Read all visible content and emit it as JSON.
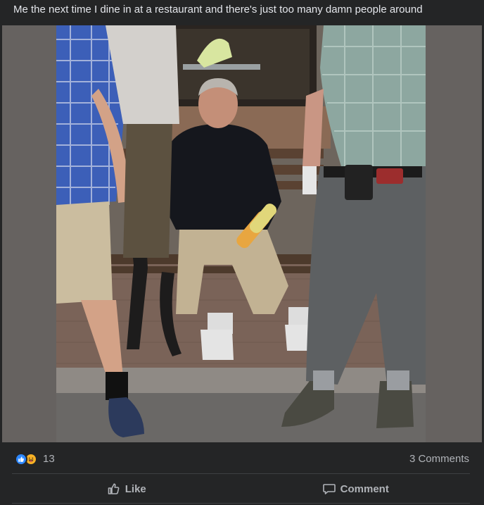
{
  "post": {
    "caption": "Me the next time I dine in at a restaurant and there's just too many damn people around"
  },
  "stats": {
    "reaction_icons": [
      "like-icon",
      "haha-icon"
    ],
    "reaction_count": "13",
    "comments_label": "3 Comments"
  },
  "actions": {
    "like_label": "Like",
    "comment_label": "Comment"
  },
  "colors": {
    "background": "#242526",
    "text_secondary": "#b0b3b8",
    "like_blue": "#2d88ff",
    "haha_yellow": "#f7b125"
  }
}
